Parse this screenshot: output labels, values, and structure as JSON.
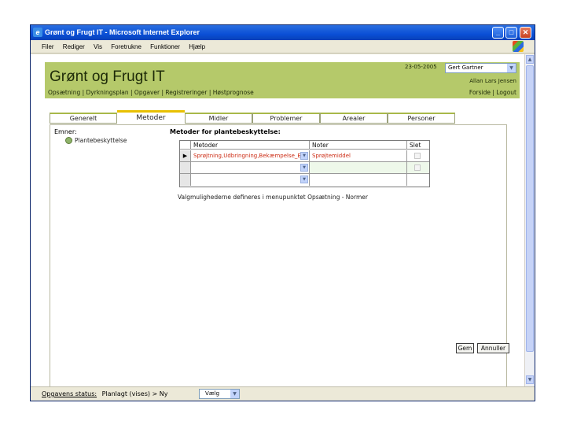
{
  "window": {
    "title": "Grønt og Frugt IT - Microsoft Internet Explorer",
    "controls": {
      "minimize": "_",
      "maximize": "□",
      "close": "✕"
    }
  },
  "menu": [
    "Filer",
    "Rediger",
    "Vis",
    "Foretrukne",
    "Funktioner",
    "Hjælp"
  ],
  "header": {
    "app_title": "Grønt og Frugt IT",
    "date": "23-05-2005",
    "user_select": "Gert Gartner",
    "user_name": "Allan Lars Jensen",
    "nav": [
      "Opsætning",
      "Dyrkningsplan",
      "Opgaver",
      "Registreringer",
      "Høstprognose"
    ],
    "nav_sep": " | ",
    "nav_right": [
      "Forside",
      "Logout"
    ],
    "color": "#b5c96a"
  },
  "tabs": [
    {
      "label": "Generelt",
      "active": false
    },
    {
      "label": "Metoder",
      "active": true
    },
    {
      "label": "Midler",
      "active": false
    },
    {
      "label": "Problemer",
      "active": false
    },
    {
      "label": "Arealer",
      "active": false
    },
    {
      "label": "Personer",
      "active": false
    }
  ],
  "panel": {
    "emner_label": "Emner:",
    "emne_item": "Plantebeskyttelse",
    "metoder_label": "Metoder for plantebeskyttelse:",
    "grid": {
      "columns": [
        "Metoder",
        "Noter",
        "Slet"
      ],
      "rows": [
        {
          "marker": "▶",
          "metode": "Sprøjtning,Udbringning,Bekæmpelse_E",
          "note": "Sprøjtemiddel"
        },
        {
          "marker": "",
          "metode": "",
          "note": ""
        },
        {
          "marker": "",
          "metode": "",
          "note": ""
        }
      ]
    },
    "note_text": "Valgmulighederne defineres i menupunktet Opsætning - Normer",
    "buttons": {
      "save": "Gem",
      "cancel": "Annuller"
    }
  },
  "statusbar": {
    "label": "Opgavens status:",
    "value": "Planlagt (vises) > Ny",
    "select": "Vælg"
  }
}
